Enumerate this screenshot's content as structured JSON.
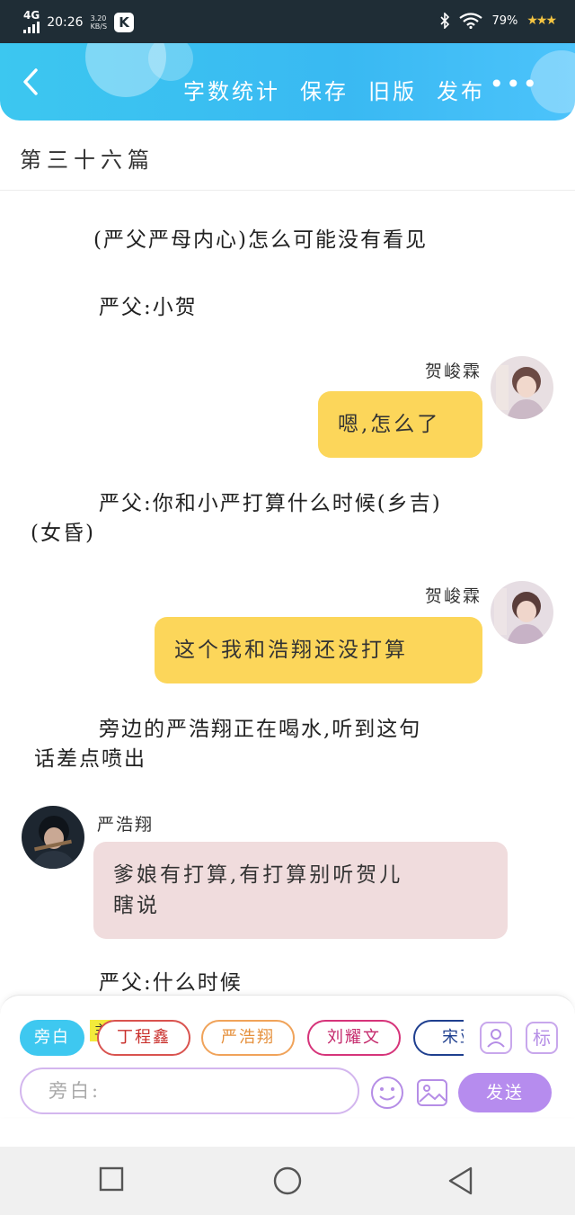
{
  "status_bar": {
    "network": "4G",
    "time": "20:26",
    "speed_value": "3.20",
    "speed_unit": "KB/S",
    "app_badge": "K",
    "battery": "79%",
    "icons": [
      "signal-icon",
      "k-app-icon",
      "bluetooth-icon",
      "wifi-icon",
      "stars-icon"
    ]
  },
  "header": {
    "actions": [
      "字数统计",
      "保存",
      "旧版",
      "发布"
    ],
    "more_label": "•••"
  },
  "chapter_title": "第三十六篇",
  "story": {
    "para1": "(严父严母内心)怎么可能没有看见",
    "para2": "严父:小贺",
    "speaker1": "贺峻霖",
    "bubble1": "嗯,怎么了",
    "para3_line1": "严父:你和小严打算什么时候(乡吉)",
    "para3_line2": "(女昏)",
    "speaker2": "贺峻霖",
    "bubble2": "这个我和浩翔还没打算",
    "para4_line1": "旁边的严浩翔正在喝水,听到这句",
    "para4_line2": "话差点喷出",
    "speaker3": "严浩翔",
    "bubble3_line1": "爹娘有打算,有打算别听贺儿",
    "bubble3_line2": "瞎说",
    "para5": "严父:什么时候"
  },
  "composer": {
    "chips": [
      "旁白",
      "丁程鑫",
      "严浩翔",
      "刘耀文",
      "宋亚"
    ],
    "main_badge": "主",
    "biao_label": "标",
    "input_placeholder": "旁白:",
    "send_label": "发送"
  },
  "colors": {
    "header_blue": "#3cc7f0",
    "bubble_yellow": "#fcd65a",
    "bubble_pink": "#f0dcdd",
    "send_purple": "#b68cee"
  }
}
